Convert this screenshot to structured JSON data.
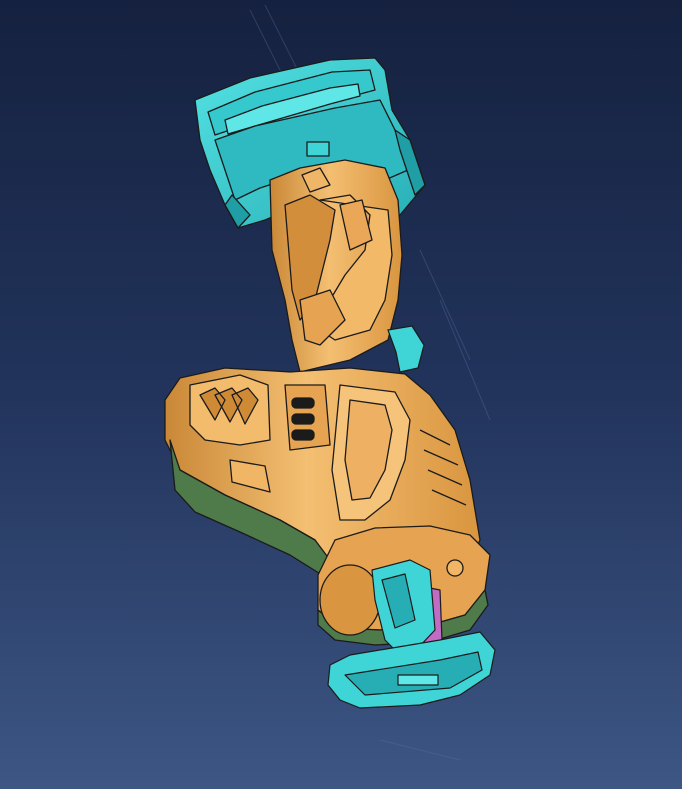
{
  "viewport": {
    "background_top": "#15213f",
    "background_bottom": "#3d5684"
  },
  "model": {
    "subject": "reciprocating-saw-cad-model",
    "colors": {
      "body": "#e8a54c",
      "body_light": "#f6c57a",
      "body_dark": "#b87a2c",
      "battery": "#3fd4d6",
      "battery_dark": "#1f9ea6",
      "accent_green": "#4f7a4a",
      "blade_mechanism": "#c06bc4",
      "edge_lines": "#2a2a2a"
    }
  }
}
